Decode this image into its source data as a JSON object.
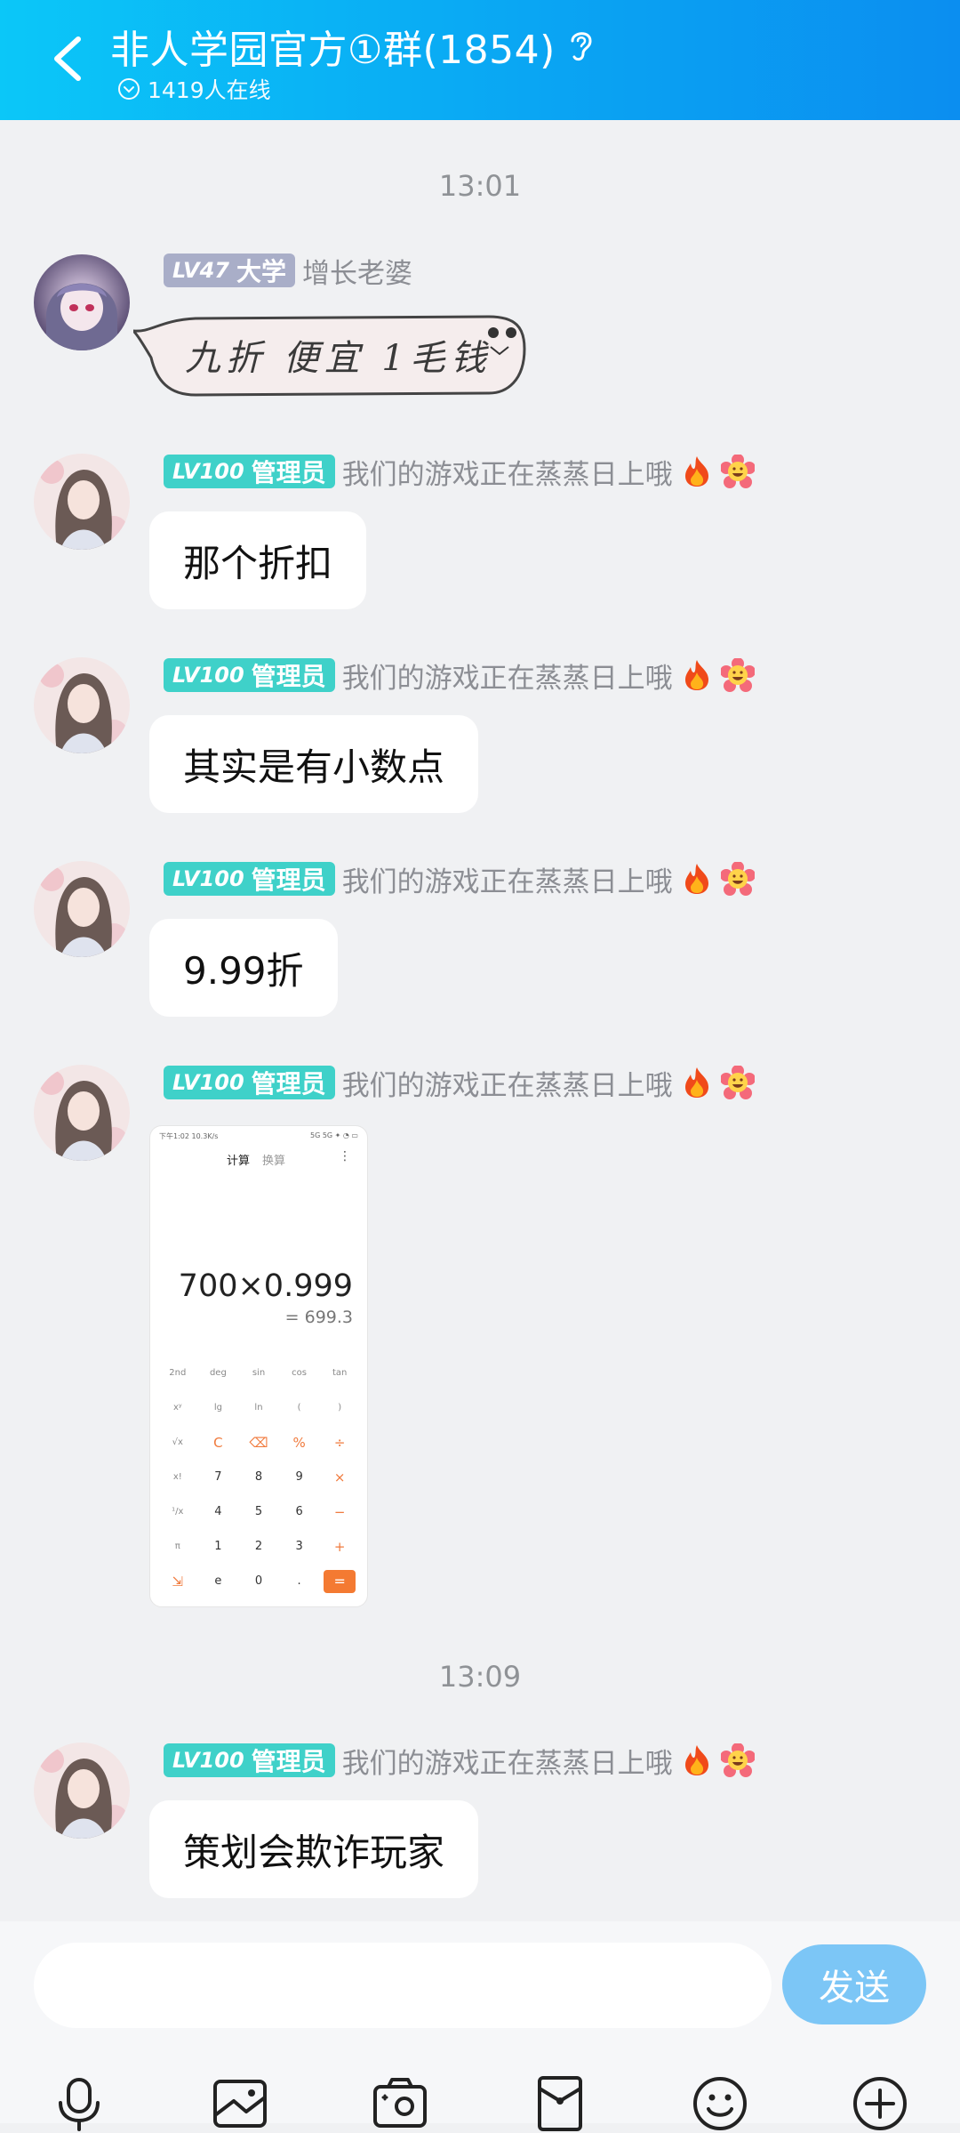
{
  "header": {
    "title": "非人学园官方①群(1854)",
    "online": "1419人在线"
  },
  "timestamps": [
    "13:01",
    "13:09"
  ],
  "messages": [
    {
      "badge_level": "LV47",
      "badge_role": "大学",
      "nick": "增长老婆",
      "sticker_text": "九折 便宜 1毛钱"
    },
    {
      "badge_level": "LV100",
      "badge_role": "管理员",
      "nick": "我们的游戏正在蒸蒸日上哦",
      "text": "那个折扣"
    },
    {
      "badge_level": "LV100",
      "badge_role": "管理员",
      "nick": "我们的游戏正在蒸蒸日上哦",
      "text": "其实是有小数点"
    },
    {
      "badge_level": "LV100",
      "badge_role": "管理员",
      "nick": "我们的游戏正在蒸蒸日上哦",
      "text": "9.99折"
    },
    {
      "badge_level": "LV100",
      "badge_role": "管理员",
      "nick": "我们的游戏正在蒸蒸日上哦",
      "image": {
        "status_left": "下午1:02 10.3K/s",
        "status_right": "5G 5G ✦ ◔ ▭",
        "tab_active": "计算",
        "tab_inactive": "换算",
        "menu": "⋮",
        "expression": "700×0.999",
        "result": "= 699.3",
        "keys": [
          "2nd",
          "deg",
          "sin",
          "cos",
          "tan",
          "xʸ",
          "lg",
          "ln",
          "(",
          ")",
          "√x",
          "C",
          "⌫",
          "%",
          "÷",
          "x!",
          "7",
          "8",
          "9",
          "×",
          "¹/x",
          "4",
          "5",
          "6",
          "−",
          "π",
          "1",
          "2",
          "3",
          "+",
          "⇲",
          "e",
          "0",
          ".",
          "="
        ]
      }
    },
    {
      "badge_level": "LV100",
      "badge_role": "管理员",
      "nick": "我们的游戏正在蒸蒸日上哦",
      "text": "策划会欺诈玩家"
    }
  ],
  "input": {
    "placeholder": "",
    "send_label": "发送"
  },
  "toolbar": [
    "microphone-icon",
    "photo-icon",
    "camera-icon",
    "red-packet-icon",
    "emoji-icon",
    "plus-icon"
  ],
  "colors": {
    "header_gradient": [
      "#0bc7f8",
      "#0b8ef0"
    ],
    "admin_badge": "#3fd1c9",
    "member_badge": "#a9aec8",
    "send_button": "#7cc6f6"
  }
}
